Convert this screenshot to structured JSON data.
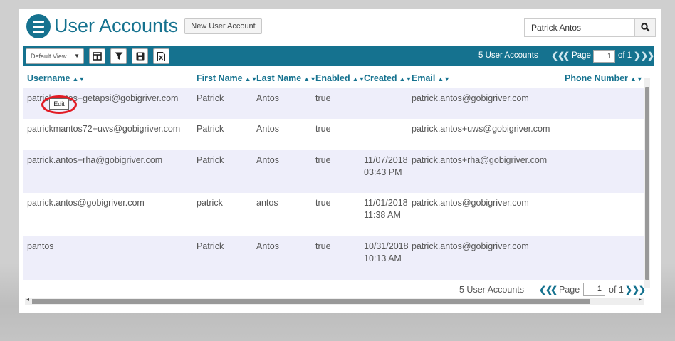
{
  "header": {
    "title": "User Accounts",
    "new_button": "New User Account",
    "search_value": "Patrick Antos"
  },
  "toolbar": {
    "view_select": "Default View",
    "count_text": "5 User Accounts",
    "page_label": "Page",
    "page_value": "1",
    "of_text": "of 1"
  },
  "columns": [
    "Username",
    "First Name",
    "Last Name",
    "Enabled",
    "Created",
    "Email",
    "Phone Number"
  ],
  "rows": [
    {
      "username": "patrick.antos+getapsi@gobigriver.com",
      "first": "Patrick",
      "last": "Antos",
      "enabled": "true",
      "created_date": "",
      "created_time": "",
      "email": "patrick.antos@gobigriver.com",
      "phone": ""
    },
    {
      "username": "patrickmantos72+uws@gobigriver.com",
      "first": "Patrick",
      "last": "Antos",
      "enabled": "true",
      "created_date": "",
      "created_time": "",
      "email": "patrick.antos+uws@gobigriver.com",
      "phone": ""
    },
    {
      "username": "patrick.antos+rha@gobigriver.com",
      "first": "Patrick",
      "last": "Antos",
      "enabled": "true",
      "created_date": "11/07/2018",
      "created_time": "03:43 PM",
      "email": "patrick.antos+rha@gobigriver.com",
      "phone": ""
    },
    {
      "username": "patrick.antos@gobigriver.com",
      "first": "patrick",
      "last": "antos",
      "enabled": "true",
      "created_date": "11/01/2018",
      "created_time": "11:38 AM",
      "email": "patrick.antos@gobigriver.com",
      "phone": ""
    },
    {
      "username": "pantos",
      "first": "Patrick",
      "last": "Antos",
      "enabled": "true",
      "created_date": "10/31/2018",
      "created_time": "10:13 AM",
      "email": "patrick.antos@gobigriver.com",
      "phone": ""
    }
  ],
  "footer": {
    "count_text": "5 User Accounts",
    "page_label": "Page",
    "page_value": "1",
    "of_text": "of 1"
  },
  "tooltip": {
    "edit_label": "Edit"
  },
  "colors": {
    "accent": "#15728f",
    "alt_row": "#eeeefa",
    "highlight": "#e21b24"
  },
  "icons": [
    "menu-icon",
    "search-icon",
    "columns-icon",
    "filter-icon",
    "save-icon",
    "excel-export-icon",
    "first-page-icon",
    "prev-page-icon",
    "next-page-icon",
    "last-page-icon"
  ]
}
